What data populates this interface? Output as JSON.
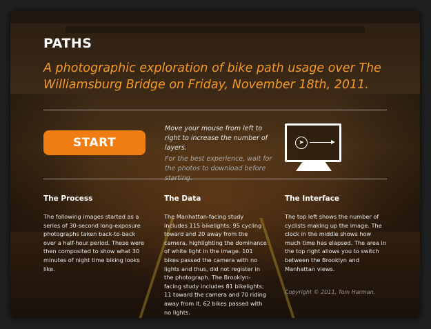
{
  "header": {
    "title": "PATHS",
    "subtitle": "A photographic exploration of bike path usage over The Williamsburg Bridge on Friday, November 18th, 2011."
  },
  "start": {
    "label": "START"
  },
  "instructions": {
    "main": "Move your mouse from left to right to increase the number of layers.",
    "tip": "For the best experience, wait for the photos to download before starting."
  },
  "icons": {
    "monitor": "monitor-icon",
    "cursor": "cursor-icon",
    "arrow": "arrow-right-icon"
  },
  "sections": [
    {
      "heading": "The Process",
      "body": "The following images started as a series of 30-second long-exposure photographs taken back-to-back over a half-hour period. These were then composited to show what 30 minutes of night time biking looks like."
    },
    {
      "heading": "The Data",
      "body": "The Manhattan-facing study includes 115 bikelights; 95 cycling toward and 20 away from the camera, highlighting the dominance of white light in the image. 101 bikes passed the camera with no lights and thus, did not register in the photograph. The Brooklyn-facing study includes 81 bikelights; 11 toward the camera and 70 riding away from it. 62 bikes passed with no lights."
    },
    {
      "heading": "The Interface",
      "body": "The top left shows the number of cyclists making up the image. The clock in the middle shows how much time has elapsed. The area in the top right allows you to switch between the Brooklyn and Manhattan views."
    }
  ],
  "footer": {
    "copyright": "Copyright © 2011, Tom Harman."
  },
  "colors": {
    "accent": "#f07d12",
    "subtitle": "#f39a2b"
  }
}
